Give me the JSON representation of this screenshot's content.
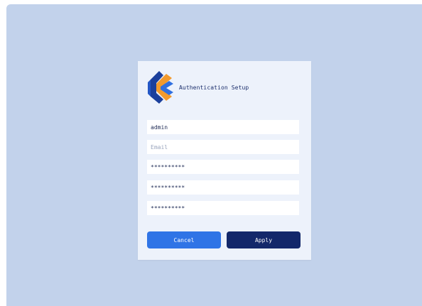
{
  "dialog": {
    "title": "Authentication Setup",
    "logo_icon": "layered-chevron-logo-icon"
  },
  "form": {
    "username_value": "admin",
    "email_placeholder": "Email",
    "password_value": "**********",
    "confirm_password_value": "**********",
    "secret_value": "**********"
  },
  "actions": {
    "cancel_label": "Cancel",
    "apply_label": "Apply"
  },
  "colors": {
    "background": "#c2d2eb",
    "card": "#edf2fb",
    "cancel_button": "#2f74e6",
    "apply_button": "#13286a",
    "logo_blue": "#2457c5",
    "logo_orange": "#f29a2e"
  }
}
